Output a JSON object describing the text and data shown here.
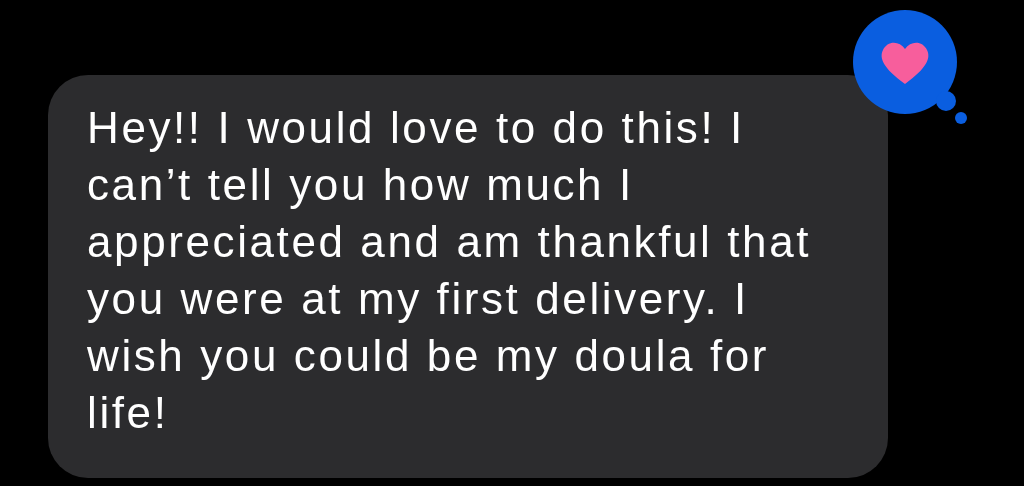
{
  "message": {
    "text": "Hey!! I would love to do this! I can’t tell you how much I appreciated and am thankful that you were at my first delivery. I wish you could be my doula for life!"
  }
}
